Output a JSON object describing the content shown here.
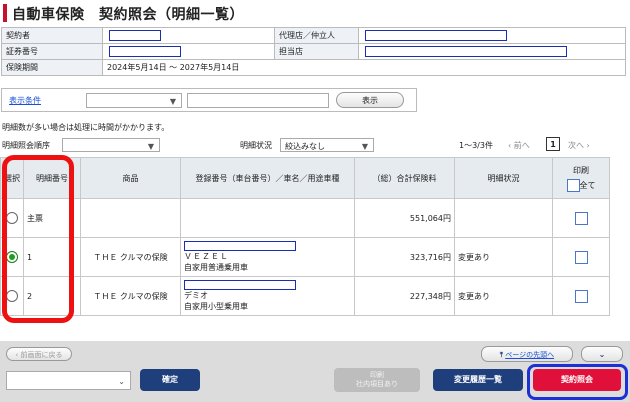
{
  "page": {
    "title": "自動車保険　契約照会（明細一覧）"
  },
  "info": {
    "contractor_label": "契約者",
    "agency_label": "代理店／仲立人",
    "policy_no_label": "証券番号",
    "branch_label": "担当店",
    "period_label": "保険期間",
    "period_value": "2024年5月14日 ～ 2027年5月14日"
  },
  "conditions": {
    "link": "表示条件",
    "display_button": "表示"
  },
  "note": "明細数が多い場合は処理に時間がかかります。",
  "controls": {
    "order_label": "明細照会順序",
    "status_label": "明細状況",
    "status_value": "絞込みなし",
    "paging": "1～3/3件",
    "prev": "前へ",
    "page": "1",
    "next": "次へ"
  },
  "table": {
    "headers": {
      "select": "選択",
      "detail_no": "明細番号",
      "product": "商品",
      "vehicle": "登録番号（車台番号）／車名／用途車種",
      "premium": "（総）合計保険料",
      "status": "明細状況",
      "print": "印刷",
      "all": "全て"
    },
    "rows": [
      {
        "no": "主票",
        "product": "",
        "vehicle_name": "",
        "usage": "",
        "premium": "551,064円",
        "status": "",
        "selected": false
      },
      {
        "no": "1",
        "product": "ＴＨＥ クルマの保険",
        "vehicle_name": "ＶＥＺＥＬ",
        "usage": "自家用普通乗用車",
        "premium": "323,716円",
        "status": "変更あり",
        "selected": true
      },
      {
        "no": "2",
        "product": "ＴＨＥ クルマの保険",
        "vehicle_name": "デミオ",
        "usage": "自家用小型乗用車",
        "premium": "227,348円",
        "status": "変更あり",
        "selected": false
      }
    ]
  },
  "footer": {
    "back": "前画面に戻る",
    "page_top": "ページの先頭へ",
    "confirm": "確定",
    "print_line1": "印刷",
    "print_line2": "社内項目あり",
    "history": "変更履歴一覧",
    "inquiry": "契約照会"
  },
  "colors": {
    "accent": "#c8102e",
    "navy": "#1f3e7c",
    "red_button": "#e0103a"
  }
}
